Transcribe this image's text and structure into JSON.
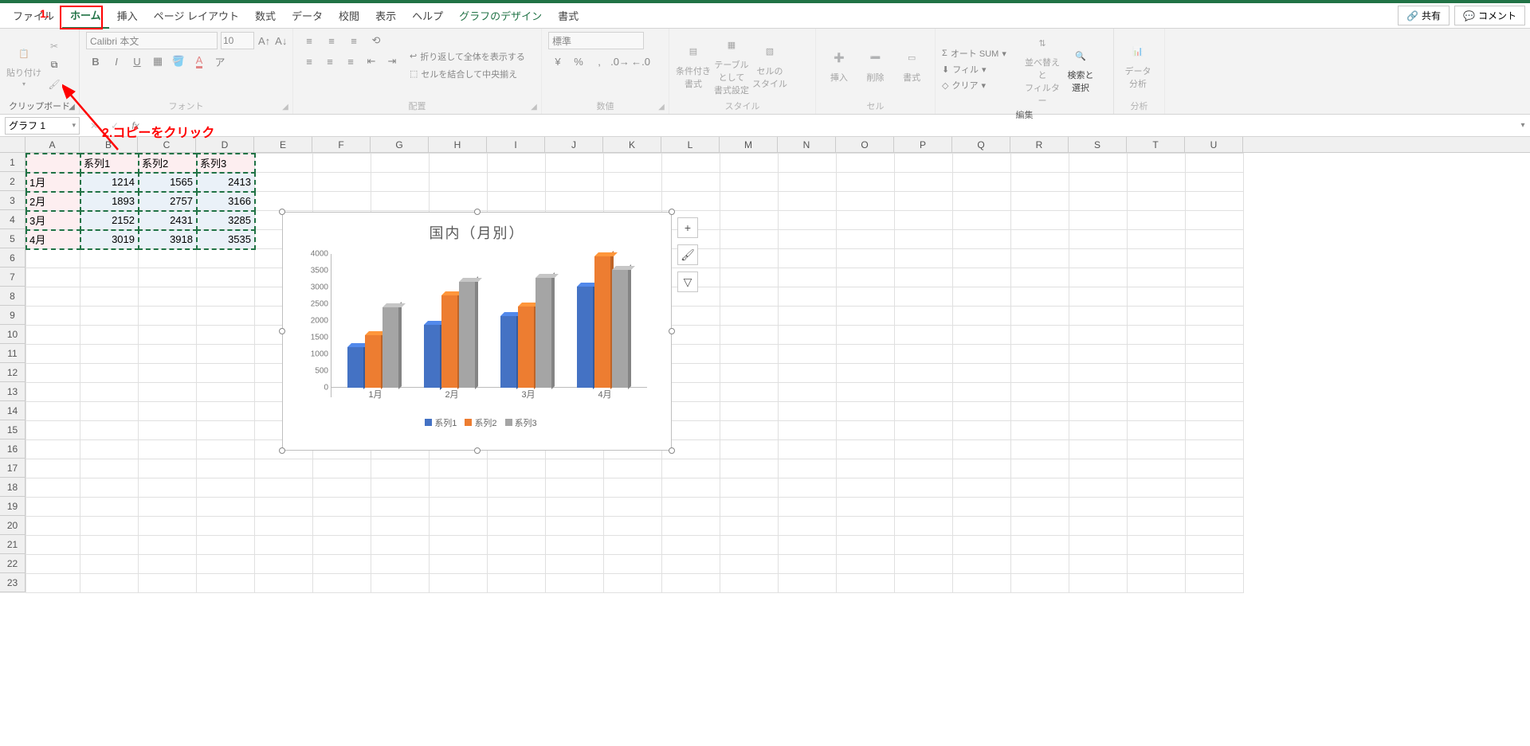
{
  "tabs": {
    "file": "ファイル",
    "home": "ホーム",
    "insert": "挿入",
    "pagelayout": "ページ レイアウト",
    "formulas": "数式",
    "data": "データ",
    "review": "校閲",
    "view": "表示",
    "help": "ヘルプ",
    "chartdesign": "グラフのデザイン",
    "format": "書式"
  },
  "topright": {
    "share": "共有",
    "comment": "コメント"
  },
  "annotations": {
    "one": "1.",
    "two": "2.コピーをクリック"
  },
  "ribbon": {
    "clipboard": {
      "label": "クリップボード",
      "paste": "貼り付け"
    },
    "font": {
      "label": "フォント",
      "fontname": "Calibri 本文",
      "fontsize": "10",
      "bold": "B",
      "italic": "I",
      "underline": "U"
    },
    "alignment": {
      "label": "配置",
      "wrap": "折り返して全体を表示する",
      "merge": "セルを結合して中央揃え"
    },
    "number": {
      "label": "数値",
      "format": "標準"
    },
    "styles": {
      "label": "スタイル",
      "cond": "条件付き\n書式",
      "table": "テーブルとして\n書式設定",
      "cell": "セルの\nスタイル"
    },
    "cells": {
      "label": "セル",
      "insert": "挿入",
      "delete": "削除",
      "format": "書式"
    },
    "editing": {
      "label": "編集",
      "autosum": "オート SUM",
      "fill": "フィル",
      "clear": "クリア",
      "sort": "並べ替えと\nフィルター",
      "find": "検索と\n選択"
    },
    "analysis": {
      "label": "分析",
      "data": "データ\n分析"
    }
  },
  "namebox": "グラフ 1",
  "columns": [
    "A",
    "B",
    "C",
    "D",
    "E",
    "F",
    "G",
    "H",
    "I",
    "J",
    "K",
    "L",
    "M",
    "N",
    "O",
    "P",
    "Q",
    "R",
    "S",
    "T",
    "U"
  ],
  "rows": [
    1,
    2,
    3,
    4,
    5,
    6,
    7,
    8,
    9,
    10,
    11,
    12,
    13,
    14,
    15,
    16,
    17,
    18,
    19,
    20,
    21,
    22,
    23
  ],
  "sheet": {
    "headers": [
      "",
      "系列1",
      "系列2",
      "系列3"
    ],
    "data": [
      [
        "1月",
        1214,
        1565,
        2413
      ],
      [
        "2月",
        1893,
        2757,
        3166
      ],
      [
        "3月",
        2152,
        2431,
        3285
      ],
      [
        "4月",
        3019,
        3918,
        3535
      ]
    ]
  },
  "chart_data": {
    "type": "bar",
    "title": "国内（月別）",
    "categories": [
      "1月",
      "2月",
      "3月",
      "4月"
    ],
    "series": [
      {
        "name": "系列1",
        "values": [
          1214,
          1893,
          2152,
          3019
        ],
        "color": "#4472C4"
      },
      {
        "name": "系列2",
        "values": [
          1565,
          2757,
          2431,
          3918
        ],
        "color": "#ED7D31"
      },
      {
        "name": "系列3",
        "values": [
          2413,
          3166,
          3285,
          3535
        ],
        "color": "#A5A5A5"
      }
    ],
    "ylim": [
      0,
      4000
    ],
    "yticks": [
      0,
      500,
      1000,
      1500,
      2000,
      2500,
      3000,
      3500,
      4000
    ],
    "xlabel": "",
    "ylabel": ""
  }
}
